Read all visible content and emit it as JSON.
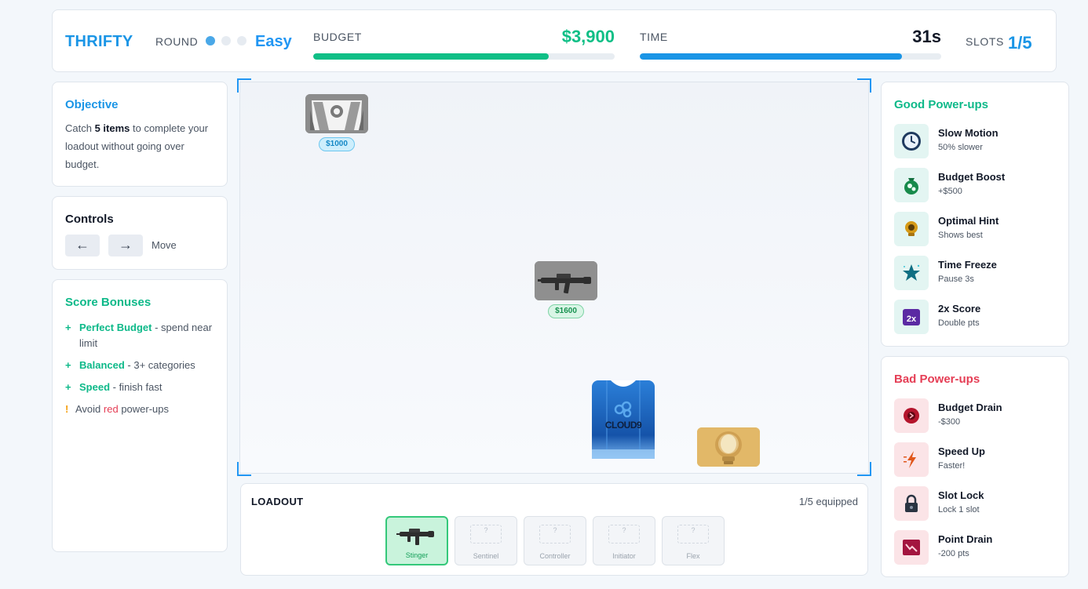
{
  "header": {
    "logo": "THRIFTY",
    "round_label": "ROUND",
    "round_total": 3,
    "round_current": 1,
    "difficulty": "Easy",
    "budget_label": "BUDGET",
    "budget_value": "$3,900",
    "budget_fraction": 0.78,
    "time_label": "TIME",
    "time_value": "31s",
    "time_fraction": 0.87,
    "slots_label": "SLOTS",
    "slots_value": "1/5",
    "colors": {
      "accent": "#1a95e6",
      "budget": "#0fbf86",
      "time": "#1a95e6"
    }
  },
  "objective": {
    "title": "Objective",
    "text_before": "Catch ",
    "text_bold": "5 items",
    "text_after": " to complete your loadout without going over budget."
  },
  "controls": {
    "title": "Controls",
    "left_key": "←",
    "right_key": "→",
    "move_label": "Move"
  },
  "bonuses": {
    "title": "Score Bonuses",
    "items": [
      {
        "marker": "+",
        "name": "Perfect Budget",
        "desc": " - spend near limit"
      },
      {
        "marker": "+",
        "name": "Balanced",
        "desc": " - 3+ categories"
      },
      {
        "marker": "+",
        "name": "Speed",
        "desc": " - finish fast"
      }
    ],
    "warning": {
      "marker": "!",
      "before": "Avoid ",
      "highlight": "red",
      "after": " power-ups"
    }
  },
  "arena": {
    "falling_items": [
      {
        "icon": "agent-card-icon",
        "price": "$1000"
      },
      {
        "icon": "smg-icon",
        "price": "$1600"
      }
    ],
    "player_card_text": "CLOUD9",
    "powerup_card_icon": "lightbulb-icon"
  },
  "loadout": {
    "title": "LOADOUT",
    "count": "1/5 equipped",
    "slots": [
      {
        "label": "Stinger",
        "filled": true,
        "placeholder": ""
      },
      {
        "label": "Sentinel",
        "filled": false,
        "placeholder": "?"
      },
      {
        "label": "Controller",
        "filled": false,
        "placeholder": "?"
      },
      {
        "label": "Initiator",
        "filled": false,
        "placeholder": "?"
      },
      {
        "label": "Flex",
        "filled": false,
        "placeholder": "?"
      }
    ]
  },
  "good_powerups": {
    "title": "Good Power-ups",
    "items": [
      {
        "name": "Slow Motion",
        "desc": "50% slower",
        "icon": "clock-icon"
      },
      {
        "name": "Budget Boost",
        "desc": "+$500",
        "icon": "money-bag-icon"
      },
      {
        "name": "Optimal Hint",
        "desc": "Shows best",
        "icon": "lightbulb-icon"
      },
      {
        "name": "Time Freeze",
        "desc": "Pause 3s",
        "icon": "star-icon"
      },
      {
        "name": "2x Score",
        "desc": "Double pts",
        "icon": "double-score-icon",
        "badge": "2x"
      }
    ]
  },
  "bad_powerups": {
    "title": "Bad Power-ups",
    "items": [
      {
        "name": "Budget Drain",
        "desc": "-$300",
        "icon": "drain-icon"
      },
      {
        "name": "Speed Up",
        "desc": "Faster!",
        "icon": "lightning-icon"
      },
      {
        "name": "Slot Lock",
        "desc": "Lock 1 slot",
        "icon": "lock-icon"
      },
      {
        "name": "Point Drain",
        "desc": "-200 pts",
        "icon": "chart-down-icon"
      }
    ]
  }
}
